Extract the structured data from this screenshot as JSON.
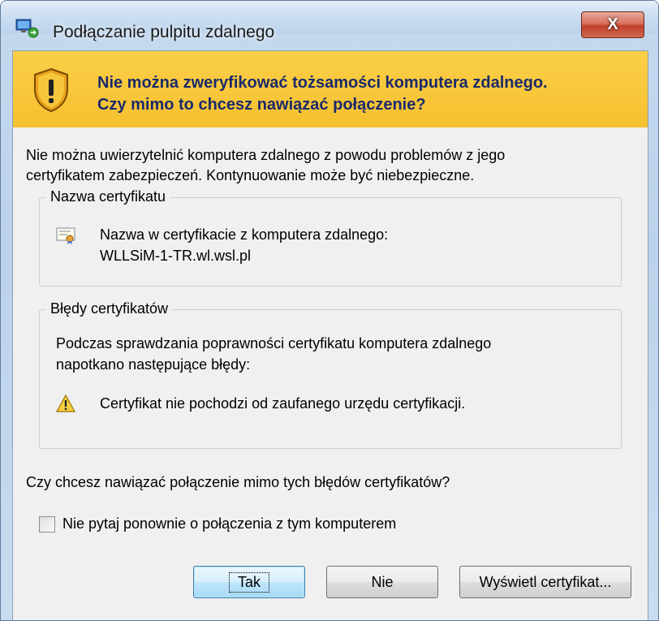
{
  "window": {
    "title": "Podłączanie pulpitu zdalnego",
    "close_label": "X"
  },
  "banner": {
    "line1": "Nie można zweryfikować tożsamości komputera zdalnego.",
    "line2": "Czy mimo to chcesz nawiązać połączenie?"
  },
  "intro": {
    "line1": "Nie można uwierzytelnić komputera zdalnego z powodu problemów z jego",
    "line2": "certyfikatem zabezpieczeń. Kontynuowanie może być niebezpieczne."
  },
  "cert_name_group": {
    "legend": "Nazwa certyfikatu",
    "label": "Nazwa w certyfikacie z komputera zdalnego:",
    "value": "WLLSiM-1-TR.wl.wsl.pl"
  },
  "cert_errors_group": {
    "legend": "Błędy certyfikatów",
    "line1": "Podczas sprawdzania poprawności certyfikatu komputera zdalnego",
    "line2": "napotkano następujące błędy:",
    "error": "Certyfikat nie pochodzi od zaufanego urzędu certyfikacji."
  },
  "question": "Czy chcesz nawiązać połączenie mimo tych błędów certyfikatów?",
  "checkbox": {
    "label": "Nie pytaj ponownie o połączenia z tym komputerem",
    "checked": false
  },
  "buttons": {
    "yes": "Tak",
    "no": "Nie",
    "view_cert": "Wyświetl certyfikat..."
  },
  "colors": {
    "banner": "#f6c02f",
    "banner_text": "#1a2a6a",
    "close_button": "#c1402a"
  }
}
